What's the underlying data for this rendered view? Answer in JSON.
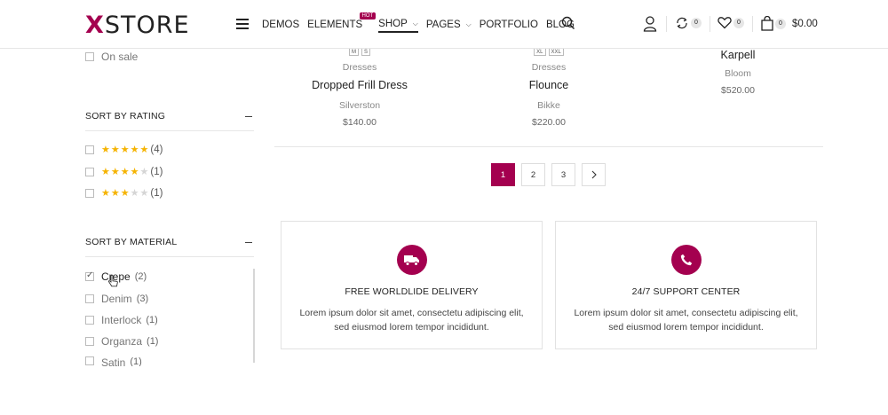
{
  "header": {
    "logo_x": "X",
    "logo_rest": "STORE",
    "nav": [
      {
        "label": "DEMOS"
      },
      {
        "label": "ELEMENTS",
        "badge": "HOT"
      },
      {
        "label": "SHOP",
        "active": true
      },
      {
        "label": "PAGES"
      },
      {
        "label": "PORTFOLIO"
      },
      {
        "label": "BLOG"
      }
    ],
    "compare_count": "0",
    "wishlist_count": "0",
    "cart_count": "0",
    "cart_total": "$0.00",
    "accent": "#a4004f"
  },
  "sidebar": {
    "on_sale": "On sale",
    "rating_title": "SORT BY RATING",
    "ratings": [
      {
        "stars": 5,
        "count": "(4)"
      },
      {
        "stars": 4,
        "count": "(1)"
      },
      {
        "stars": 3,
        "count": "(1)"
      }
    ],
    "material_title": "SORT BY MATERIAL",
    "materials": [
      {
        "label": "Crepe",
        "count": "(2)",
        "checked": true
      },
      {
        "label": "Denim",
        "count": "(3)",
        "checked": false
      },
      {
        "label": "Interlock",
        "count": "(1)",
        "checked": false
      },
      {
        "label": "Organza",
        "count": "(1)",
        "checked": false
      },
      {
        "label": "Satin",
        "count": "(1)",
        "checked": false
      }
    ]
  },
  "products": [
    {
      "sizes": [
        "M",
        "S"
      ],
      "category": "Dresses",
      "name": "Dropped Frill Dress",
      "brand": "Silverston",
      "price": "$140.00"
    },
    {
      "sizes": [
        "XL",
        "XXL"
      ],
      "category": "Dresses",
      "name": "Flounce",
      "brand": "Bikke",
      "price": "$220.00"
    },
    {
      "sizes": [],
      "category": "",
      "name": "Karpell",
      "brand": "Bloom",
      "price": "$520.00"
    }
  ],
  "pagination": {
    "pages": [
      "1",
      "2",
      "3"
    ],
    "current": "1",
    "next_icon": "chevron-right-icon"
  },
  "features": [
    {
      "icon": "truck-icon",
      "title": "FREE WORLDLIDE DELIVERY",
      "line1": "Lorem ipsum dolor sit amet, consectetu adipiscing elit,",
      "line2": "sed eiusmod lorem tempor incididunt."
    },
    {
      "icon": "phone-icon",
      "title": "24/7 SUPPORT CENTER",
      "line1": "Lorem ipsum dolor sit amet, consectetu adipiscing elit,",
      "line2": "sed eiusmod lorem tempor incididunt."
    }
  ]
}
